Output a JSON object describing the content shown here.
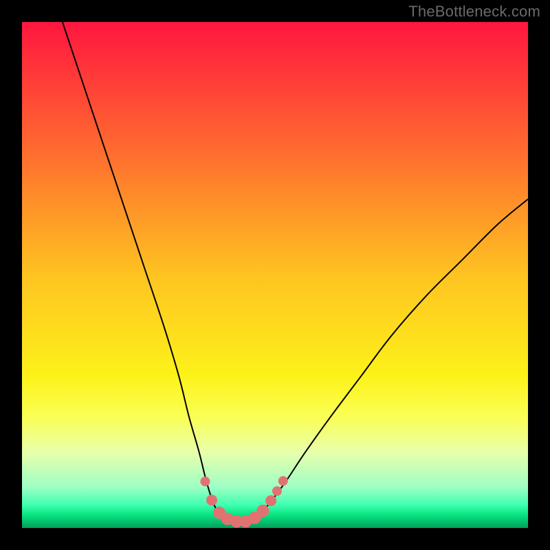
{
  "watermark": "TheBottleneck.com",
  "chart_data": {
    "type": "line",
    "title": "",
    "xlabel": "",
    "ylabel": "",
    "xlim": [
      0,
      100
    ],
    "ylim": [
      0,
      100
    ],
    "grid": false,
    "legend": false,
    "background_gradient_stops": [
      {
        "offset": 0,
        "color": "#ff163f"
      },
      {
        "offset": 0.25,
        "color": "#ff6a2f"
      },
      {
        "offset": 0.5,
        "color": "#fec321"
      },
      {
        "offset": 0.7,
        "color": "#fdf21a"
      },
      {
        "offset": 0.78,
        "color": "#faff54"
      },
      {
        "offset": 0.85,
        "color": "#e8ffab"
      },
      {
        "offset": 0.92,
        "color": "#9dffc5"
      },
      {
        "offset": 0.955,
        "color": "#3dffaf"
      },
      {
        "offset": 0.975,
        "color": "#06e37e"
      },
      {
        "offset": 1.0,
        "color": "#029e5c"
      }
    ],
    "series": [
      {
        "name": "bottleneck-curve",
        "stroke": "#000000",
        "stroke_width": 2,
        "data": [
          {
            "x": 8,
            "y": 100
          },
          {
            "x": 12,
            "y": 88
          },
          {
            "x": 16,
            "y": 76
          },
          {
            "x": 20,
            "y": 64
          },
          {
            "x": 24,
            "y": 52
          },
          {
            "x": 28,
            "y": 40
          },
          {
            "x": 31,
            "y": 30
          },
          {
            "x": 33,
            "y": 22
          },
          {
            "x": 35,
            "y": 15
          },
          {
            "x": 36.5,
            "y": 9
          },
          {
            "x": 38,
            "y": 4.5
          },
          {
            "x": 39.5,
            "y": 2.2
          },
          {
            "x": 41,
            "y": 1.4
          },
          {
            "x": 43,
            "y": 1.2
          },
          {
            "x": 45,
            "y": 1.4
          },
          {
            "x": 47,
            "y": 2.8
          },
          {
            "x": 49,
            "y": 5
          },
          {
            "x": 52,
            "y": 9
          },
          {
            "x": 56,
            "y": 15
          },
          {
            "x": 61,
            "y": 22
          },
          {
            "x": 67,
            "y": 30
          },
          {
            "x": 73,
            "y": 38
          },
          {
            "x": 80,
            "y": 46
          },
          {
            "x": 87,
            "y": 53
          },
          {
            "x": 94,
            "y": 60
          },
          {
            "x": 100,
            "y": 65
          }
        ]
      }
    ],
    "markers": {
      "color": "#e27272",
      "points": [
        {
          "x": 36.2,
          "y": 9.2,
          "r": 7
        },
        {
          "x": 37.5,
          "y": 5.5,
          "r": 8
        },
        {
          "x": 39.0,
          "y": 3.0,
          "r": 9
        },
        {
          "x": 40.6,
          "y": 1.8,
          "r": 9
        },
        {
          "x": 42.4,
          "y": 1.3,
          "r": 9
        },
        {
          "x": 44.2,
          "y": 1.3,
          "r": 9
        },
        {
          "x": 46.0,
          "y": 2.0,
          "r": 9
        },
        {
          "x": 47.6,
          "y": 3.4,
          "r": 9
        },
        {
          "x": 49.2,
          "y": 5.4,
          "r": 8
        },
        {
          "x": 50.4,
          "y": 7.3,
          "r": 7
        },
        {
          "x": 51.6,
          "y": 9.3,
          "r": 7
        }
      ]
    }
  }
}
